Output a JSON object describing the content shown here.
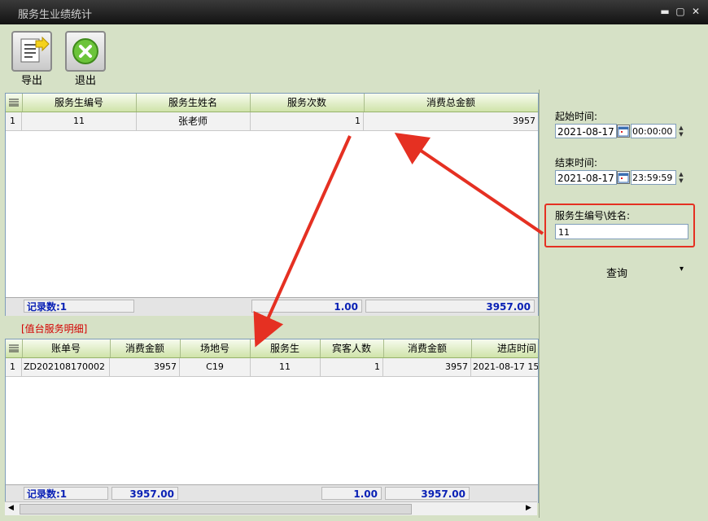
{
  "window": {
    "title": "服务生业绩统计",
    "controls": [
      "▬",
      "▢",
      "✕"
    ]
  },
  "toolbar": {
    "export_label": "导出",
    "exit_label": "退出"
  },
  "top_grid": {
    "columns": [
      "服务生编号",
      "服务生姓名",
      "服务次数",
      "消费总金额"
    ],
    "rows": [
      {
        "index": "1",
        "cells": [
          "11",
          "张老师",
          "1",
          "3957"
        ]
      }
    ],
    "footer": {
      "count_label": "记录数:1",
      "times_total": "1.00",
      "amount_total": "3957.00"
    }
  },
  "detail": {
    "section_title": "[值台服务明细]",
    "columns": [
      "账单号",
      "消费金额",
      "场地号",
      "服务生",
      "宾客人数",
      "消费金额",
      "进店时间"
    ],
    "rows": [
      {
        "index": "1",
        "cells": [
          "ZD202108170002",
          "3957",
          "C19",
          "11",
          "1",
          "3957",
          "2021-08-17 15"
        ]
      }
    ],
    "footer": {
      "count_label": "记录数:1",
      "amount_total": "3957.00",
      "guests_total": "1.00",
      "amount2_total": "3957.00"
    }
  },
  "side": {
    "start_label": "起始时间:",
    "start_date": "2021-08-17",
    "start_time": "00:00:00",
    "end_label": "结束时间:",
    "end_date": "2021-08-17",
    "end_time": "23:59:59",
    "waiter_label": "服务生编号\\姓名:",
    "waiter_value": "11",
    "query_label": "查询",
    "query_arrow": "▾"
  },
  "colors": {
    "accent_red": "#e53022",
    "total_blue": "#0a21b5",
    "header_green": "#cfe3a9"
  }
}
